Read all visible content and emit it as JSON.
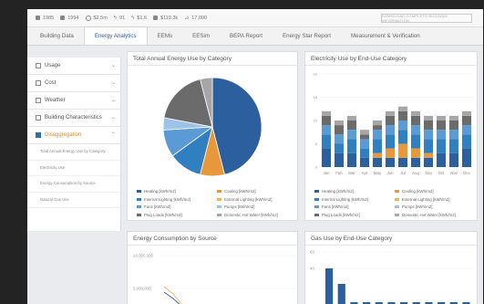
{
  "topbar": {
    "stats": [
      {
        "icon": "building-icon",
        "value": "1985"
      },
      {
        "icon": "calendar-icon",
        "value": "1994"
      },
      {
        "icon": "clock-icon",
        "value": "$2.5m"
      },
      {
        "icon": "bolt-icon",
        "value": "91"
      },
      {
        "icon": "flame-icon",
        "value": "$1.6"
      },
      {
        "icon": "dollar-icon",
        "value": "$119.3k"
      },
      {
        "icon": "area-icon",
        "value": "17,000"
      }
    ],
    "report_button": "DOWNLOAD COMPLETE BUILDING INFORMATION"
  },
  "tabs": [
    {
      "label": "Building Data",
      "active": false
    },
    {
      "label": "Energy Analytics",
      "active": true
    },
    {
      "label": "EEMs",
      "active": false
    },
    {
      "label": "EESim",
      "active": false
    },
    {
      "label": "BEPA Report",
      "active": false
    },
    {
      "label": "Energy Star Report",
      "active": false
    },
    {
      "label": "Measurement & Verification",
      "active": false
    }
  ],
  "sidebar": {
    "items": [
      {
        "label": "Usage"
      },
      {
        "label": "Cost"
      },
      {
        "label": "Weather"
      },
      {
        "label": "Building Characteristics"
      },
      {
        "label": "Disaggregation"
      }
    ],
    "subitems": [
      {
        "label": "Total Annual Energy Use by Category"
      },
      {
        "label": "Electricity Use"
      },
      {
        "label": "Energy Consumption by Source"
      },
      {
        "label": "Natural Gas Use"
      }
    ]
  },
  "panels": {
    "p1": {
      "title": "Total Annual Energy Use by Category"
    },
    "p2": {
      "title": "Electricity Use by End-Use Category"
    },
    "p3": {
      "title": "Energy Consumption by Source"
    },
    "p4": {
      "title": "Gas Use by End-Use Category"
    }
  },
  "legend": [
    {
      "label": "Heating [kWh/m2]",
      "color": "#2c5f9e"
    },
    {
      "label": "Cooling [kWh/m2]",
      "color": "#e8983a"
    },
    {
      "label": "Internal Lighting [kWh/m2]",
      "color": "#2f7fc1"
    },
    {
      "label": "External Lighting [kWh/m2]",
      "color": "#f0b35c"
    },
    {
      "label": "Fans [kWh/m2]",
      "color": "#5b9bd5"
    },
    {
      "label": "Pumps [kWh/m2]",
      "color": "#9dc3e6"
    },
    {
      "label": "Plug Loads [kWh/m2]",
      "color": "#6b6b6b"
    },
    {
      "label": "Domestic Hot Water [kWh/m2]",
      "color": "#a6a6a6"
    }
  ],
  "chart_data": [
    {
      "type": "pie",
      "title": "Total Annual Energy Use by Category",
      "slices": [
        {
          "label": "Heating [kWh/m2]",
          "value": 46
        },
        {
          "label": "Cooling [kWh/m2]",
          "value": 8
        },
        {
          "label": "Internal Lighting [kWh/m2]",
          "value": 11
        },
        {
          "label": "Fans [kWh/m2]",
          "value": 9
        },
        {
          "label": "Pumps [kWh/m2]",
          "value": 4
        },
        {
          "label": "Plug Loads [kWh/m2]",
          "value": 18
        },
        {
          "label": "Domestic Hot Water [kWh/m2]",
          "value": 4
        }
      ]
    },
    {
      "type": "bar",
      "stacked": true,
      "title": "Electricity Use by End-Use Category",
      "categories": [
        "Jan",
        "Feb",
        "Mar",
        "Apr",
        "May",
        "Jun",
        "Jul",
        "Aug",
        "Sep",
        "Oct",
        "Nov",
        "Dec"
      ],
      "ylim": [
        0,
        20
      ],
      "yticks": [
        "20",
        "15",
        "10",
        "5",
        "0"
      ],
      "series": [
        {
          "name": "Heating [kWh/m2]",
          "values": [
            4,
            3,
            3,
            2,
            2,
            2,
            2,
            2,
            2,
            3,
            3,
            4
          ]
        },
        {
          "name": "Cooling [kWh/m2]",
          "values": [
            0,
            0,
            0,
            0,
            1,
            2,
            3,
            2,
            1,
            0,
            0,
            0
          ]
        },
        {
          "name": "Internal Lighting [kWh/m2]",
          "values": [
            3,
            2,
            3,
            2,
            3,
            3,
            3,
            3,
            3,
            3,
            3,
            3
          ]
        },
        {
          "name": "Fans [kWh/m2]",
          "values": [
            2,
            2,
            2,
            2,
            2,
            2,
            2,
            2,
            2,
            2,
            2,
            2
          ]
        },
        {
          "name": "Plug Loads [kWh/m2]",
          "values": [
            2,
            2,
            2,
            1,
            1,
            2,
            2,
            2,
            2,
            2,
            2,
            2
          ]
        },
        {
          "name": "Domestic Hot Water [kWh/m2]",
          "values": [
            1,
            1,
            1,
            1,
            1,
            1,
            1,
            1,
            1,
            1,
            1,
            1
          ]
        }
      ]
    },
    {
      "type": "line",
      "title": "Energy Consumption by Source",
      "yticks": [
        "10,000,000",
        "5,000,000"
      ]
    },
    {
      "type": "bar",
      "title": "Gas Use by End-Use Category",
      "yticks": [
        "60",
        "40"
      ],
      "values": [
        42,
        25,
        5,
        5,
        5,
        5,
        5,
        5,
        5,
        5,
        5,
        5
      ]
    }
  ]
}
